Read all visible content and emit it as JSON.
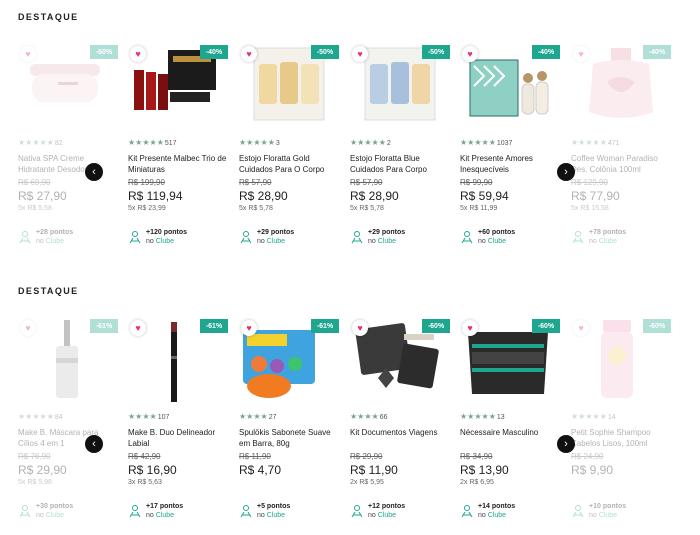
{
  "sections": [
    {
      "title": "DESTAQUE",
      "products": [
        {
          "name": "Nativa SPA Creme Hidratante Desodorante",
          "discount": "-60%",
          "rating": "★★★★★",
          "reviews": "82",
          "old_price": "R$ 69,90",
          "price": "R$ 27,90",
          "installments": "5x R$ 5,58",
          "points": "+28 pontos",
          "club_prefix": "no ",
          "club": "Clube",
          "faded": true
        },
        {
          "name": "Kit Presente Malbec Trio de Miniaturas",
          "discount": "-40%",
          "rating": "★★★★★",
          "reviews": "517",
          "old_price": "R$ 199,90",
          "price": "R$ 119,94",
          "installments": "5x R$ 23,99",
          "points": "+120 pontos",
          "club_prefix": "no ",
          "club": "Clube",
          "faded": false
        },
        {
          "name": "Estojo Floratta Gold Cuidados Para O Corpo",
          "discount": "-50%",
          "rating": "★★★★★",
          "reviews": "3",
          "old_price": "R$ 57,90",
          "price": "R$ 28,90",
          "installments": "5x R$ 5,78",
          "points": "+29 pontos",
          "club_prefix": "no ",
          "club": "Clube",
          "faded": false
        },
        {
          "name": "Estojo Floratta Blue Cuidados Para Corpo",
          "discount": "-50%",
          "rating": "★★★★★",
          "reviews": "2",
          "old_price": "R$ 57,90",
          "price": "R$ 28,90",
          "installments": "5x R$ 5,78",
          "points": "+29 pontos",
          "club_prefix": "no ",
          "club": "Clube",
          "faded": false
        },
        {
          "name": "Kit Presente Amores Inesquecíveis",
          "discount": "-40%",
          "rating": "★★★★★",
          "reviews": "1037",
          "old_price": "R$ 99,90",
          "price": "R$ 59,94",
          "installments": "5x R$ 11,99",
          "points": "+60 pontos",
          "club_prefix": "no ",
          "club": "Clube",
          "faded": false
        },
        {
          "name": "Coffee Woman Paradiso Des. Colônia 100ml",
          "discount": "-40%",
          "rating": "★★★★★",
          "reviews": "471",
          "old_price": "R$ 129,90",
          "price": "R$ 77,90",
          "installments": "5x R$ 15,58",
          "points": "+78 pontos",
          "club_prefix": "no ",
          "club": "Clube",
          "faded": true
        }
      ]
    },
    {
      "title": "DESTAQUE",
      "products": [
        {
          "name": "Make B. Máscara para Cílios 4 em 1",
          "discount": "-61%",
          "rating": "★★★★★",
          "reviews": "84",
          "old_price": "R$ 76,90",
          "price": "R$ 29,90",
          "installments": "5x R$ 5,98",
          "points": "+30 pontos",
          "club_prefix": "no ",
          "club": "Clube",
          "faded": true
        },
        {
          "name": "Make B. Duo Delineador Labial",
          "discount": "-61%",
          "rating": "★★★★",
          "reviews": "107",
          "old_price": "R$ 42,90",
          "price": "R$ 16,90",
          "installments": "3x R$ 5,63",
          "points": "+17 pontos",
          "club_prefix": "no ",
          "club": "Clube",
          "faded": false
        },
        {
          "name": "Spulökis Sabonete Suave em Barra, 80g",
          "discount": "-61%",
          "rating": "★★★★",
          "reviews": "27",
          "old_price": "R$ 11,90",
          "price": "R$ 4,70",
          "installments": "",
          "points": "+5 pontos",
          "club_prefix": "no ",
          "club": "Clube",
          "faded": false
        },
        {
          "name": "Kit Documentos Viagens",
          "discount": "-60%",
          "rating": "★★★★",
          "reviews": "66",
          "old_price": "R$ 29,90",
          "price": "R$ 11,90",
          "installments": "2x R$ 5,95",
          "points": "+12 pontos",
          "club_prefix": "no ",
          "club": "Clube",
          "faded": false
        },
        {
          "name": "Nécessaire Masculino",
          "discount": "-60%",
          "rating": "★★★★★",
          "reviews": "13",
          "old_price": "R$ 34,90",
          "price": "R$ 13,90",
          "installments": "2x R$ 6,95",
          "points": "+14 pontos",
          "club_prefix": "no ",
          "club": "Clube",
          "faded": false
        },
        {
          "name": "Petit Sophie Shampoo Cabelos Lisos, 100ml",
          "discount": "-60%",
          "rating": "★★★★★",
          "reviews": "14",
          "old_price": "R$ 24,90",
          "price": "R$ 9,90",
          "installments": "",
          "points": "+10 pontos",
          "club_prefix": "no ",
          "club": "Clube",
          "faded": true
        }
      ]
    }
  ],
  "icons": {
    "favorite": "heart-icon",
    "prev": "chevron-left-icon",
    "next": "chevron-right-icon",
    "points": "club-points-icon"
  },
  "colors": {
    "discount_badge": "#1fa68f",
    "favorite": "#e8306c",
    "stars": "#7aa58c",
    "club": "#1fa68f"
  },
  "arrows": {
    "prev": "‹",
    "next": "›"
  }
}
